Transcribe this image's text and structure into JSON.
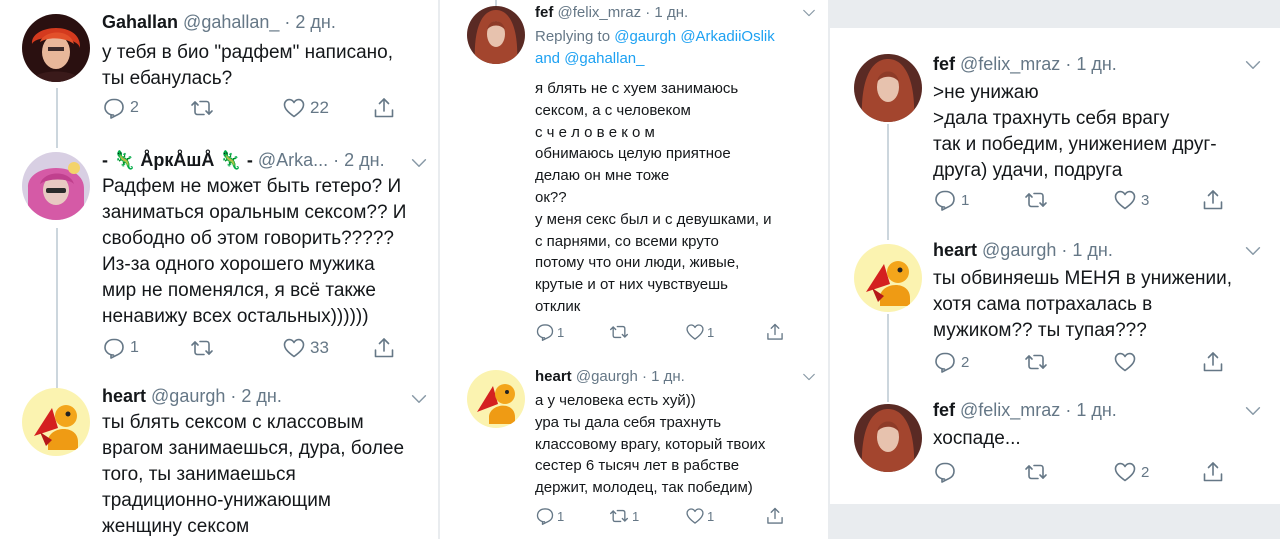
{
  "col1": {
    "tweets": [
      {
        "name": "Gahallan",
        "handle": "@gahallan_",
        "time": "· 2 дн.",
        "text": "у тебя в био \"радфем\" написано,\nты ебанулась?",
        "reply_count": "2",
        "retweet_count": "",
        "like_count": "22"
      },
      {
        "name": "- 🦎 ÅркÅшÅ 🦎 -",
        "handle": "@Arka...",
        "time": "· 2 дн.",
        "text": "Радфем не может быть гетеро? И\nзаниматься оральным сексом?? И\nсвободно об этом говорить?????\nИз-за одного хорошего мужика\nмир не поменялся, я всё также\nненавижу всех остальных))))))",
        "reply_count": "1",
        "retweet_count": "",
        "like_count": "33"
      },
      {
        "name": "heart",
        "handle": "@gaurgh",
        "time": "· 2 дн.",
        "text": "ты блять сексом с классовым\nврагом занимаешься, дура, более\nтого, ты занимаешься\nтрадиционно-унижающим\nженщину сексом"
      }
    ]
  },
  "col2": {
    "tweets": [
      {
        "name": "fef",
        "handle": "@felix_mraz",
        "time": "· 1 дн.",
        "replying_prefix": "Replying to",
        "replying_mentions": "@gaurgh @ArkadiiOslik",
        "replying_line2_prefix": "and",
        "replying_line2_mention": "@gahallan_",
        "text": "я блять не с хуем занимаюсь\nсексом, а с человеком\nс ч е л о в е к о м\nобнимаюсь целую приятное\nделаю он мне тоже\nок??\nу меня секс был и с девушками, и\nс парнями, со всеми круто\nпотому что они люди, живые,\nкрутые и от них чувствуешь\nотклик",
        "reply_count": "1",
        "retweet_count": "",
        "like_count": "1"
      },
      {
        "name": "heart",
        "handle": "@gaurgh",
        "time": "· 1 дн.",
        "text": "а у человека есть хуй))\nура ты дала себя трахнуть\nклассовому врагу, который твоих\nсестер 6 тысяч лет в рабстве\nдержит, молодец, так  победим)",
        "reply_count": "1",
        "retweet_count": "1",
        "like_count": "1"
      }
    ]
  },
  "col3": {
    "tweets": [
      {
        "name": "fef",
        "handle": "@felix_mraz",
        "time": "· 1 дн.",
        "text": ">не унижаю\n>дала трахнуть себя врагу\nтак и победим, унижением друг-\nдруга) удачи, подруга",
        "reply_count": "1",
        "retweet_count": "",
        "like_count": "3"
      },
      {
        "name": "heart",
        "handle": "@gaurgh",
        "time": "· 1 дн.",
        "text": "ты обвиняешь МЕНЯ в унижении,\nхотя сама потрахалась в\nмужиком?? ты тупая???",
        "reply_count": "2",
        "retweet_count": "",
        "like_count": ""
      },
      {
        "name": "fef",
        "handle": "@felix_mraz",
        "time": "· 1 дн.",
        "text": "хоспаде...",
        "reply_count": "",
        "retweet_count": "",
        "like_count": "2"
      }
    ]
  },
  "colors": {
    "text": "#14171a",
    "meta": "#657786",
    "link": "#1da1f2",
    "thread_line": "#ccd6dd",
    "icon": "#657786"
  }
}
